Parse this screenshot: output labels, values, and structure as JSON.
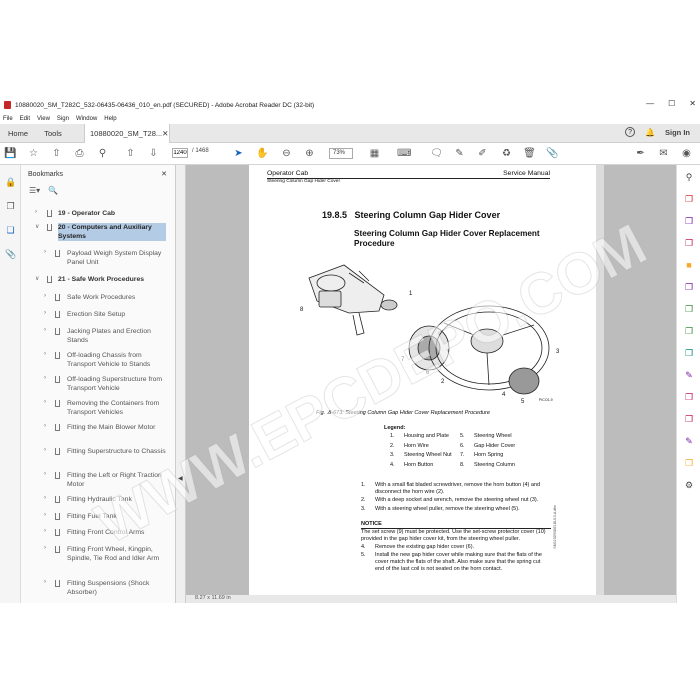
{
  "window": {
    "title": "10880020_SM_T282C_532-06435-06436_010_en.pdf (SECURED) - Adobe Acrobat Reader DC (32-bit)"
  },
  "menu": [
    "File",
    "Edit",
    "View",
    "Sign",
    "Window",
    "Help"
  ],
  "tabs": {
    "home": "Home",
    "tools": "Tools",
    "document": "10880020_SM_T28...",
    "sign_in": "Sign In"
  },
  "toolbar": {
    "current_page": "1240",
    "total_pages": "/ 1468",
    "zoom": "73%"
  },
  "bookmarks_panel": {
    "title": "Bookmarks",
    "items": [
      {
        "label": "19 - Operator Cab",
        "level": 0,
        "bold": true,
        "expanded": false
      },
      {
        "label": "20 - Computers and Auxiliary Systems",
        "level": 0,
        "bold": true,
        "expanded": true,
        "selected": true
      },
      {
        "label": "Payload Weigh System Display Panel Unit",
        "level": 1
      },
      {
        "label": "21 - Safe Work Procedures",
        "level": 0,
        "bold": true,
        "expanded": true
      },
      {
        "label": "Safe Work Procedures",
        "level": 1
      },
      {
        "label": "Erection Site Setup",
        "level": 1
      },
      {
        "label": "Jacking Plates and Erection Stands",
        "level": 1
      },
      {
        "label": "Off-loading Chassis from Transport Vehicle to Stands",
        "level": 1
      },
      {
        "label": "Off-loading Superstructure from Transport Vehicle",
        "level": 1
      },
      {
        "label": "Removing the Containers from Transport Vehicles",
        "level": 1
      },
      {
        "label": "Fitting the Main Blower Motor",
        "level": 1
      },
      {
        "label": "Fitting Superstructure to Chassis",
        "level": 1
      },
      {
        "label": "Fitting the Left or Right Traction Motor",
        "level": 1
      },
      {
        "label": "Fitting Hydraulic Tank",
        "level": 1
      },
      {
        "label": "Fitting Fuel Tank",
        "level": 1
      },
      {
        "label": "Fitting Front Control Arms",
        "level": 1
      },
      {
        "label": "Fitting Front Wheel, Kingpin, Spindle, Tie Rod and Idler Arm",
        "level": 1
      },
      {
        "label": "Fitting Suspensions (Shock Absorber)",
        "level": 1
      }
    ]
  },
  "status": {
    "page_size": "8.27 x 11.69 in"
  },
  "document": {
    "header_left": "Operator Cab",
    "header_right": "Service Manual",
    "header_sub": "Steering Column Gap Hider Cover",
    "section_number": "19.8.5",
    "section_title": "Steering Column Gap Hider Cover",
    "subsection_title": "Steering Column Gap Hider Cover Replacement Procedure",
    "figure_caption": "Fig. .8-673: Steering Column Gap Hider Cover Replacement Procedure",
    "figure_callouts": [
      "1",
      "2",
      "3",
      "4",
      "5",
      "6",
      "7",
      "8"
    ],
    "figure_code": "PICO1-9",
    "legend_title": "Legend:",
    "legend": [
      {
        "num": "1.",
        "label": "Housing and Plate"
      },
      {
        "num": "2.",
        "label": "Horn Wire"
      },
      {
        "num": "3.",
        "label": "Steering Wheel Nut"
      },
      {
        "num": "4.",
        "label": "Horn Button"
      },
      {
        "num": "5.",
        "label": "Steering Wheel"
      },
      {
        "num": "6.",
        "label": "Gap Hider Cover"
      },
      {
        "num": "7.",
        "label": "Horn Spring"
      },
      {
        "num": "8.",
        "label": "Steering Column"
      }
    ],
    "steps": [
      {
        "num": "1.",
        "text": "With a small flat bladed screwdriver, remove the horn button (4) and disconnect the horn wire (2)."
      },
      {
        "num": "2.",
        "text": "With a deep socket and wrench, remove the steering wheel nut (3)."
      },
      {
        "num": "3.",
        "text": "With a steering wheel puller, remove the steering wheel (5)."
      }
    ],
    "notice_title": "NOTICE",
    "notice_text": "The set screw (9) must be protected. Use the set-screw protector cover (10) provided in the gap hider cover kit, from the steering wheel puller.",
    "steps2": [
      {
        "num": "4.",
        "text": "Remove the existing gap hider cover (6)."
      },
      {
        "num": "5.",
        "text": "Install the new gap hider cover while making sure that the flats of the cover match the flats of the shaft. Also make sure that the spring cut end of the last coil is not seated on the horn contact."
      }
    ],
    "side_code": "SM0152R0DE1DU13-A.dfm"
  },
  "watermark": "WWW.EPCDEPO.COM"
}
